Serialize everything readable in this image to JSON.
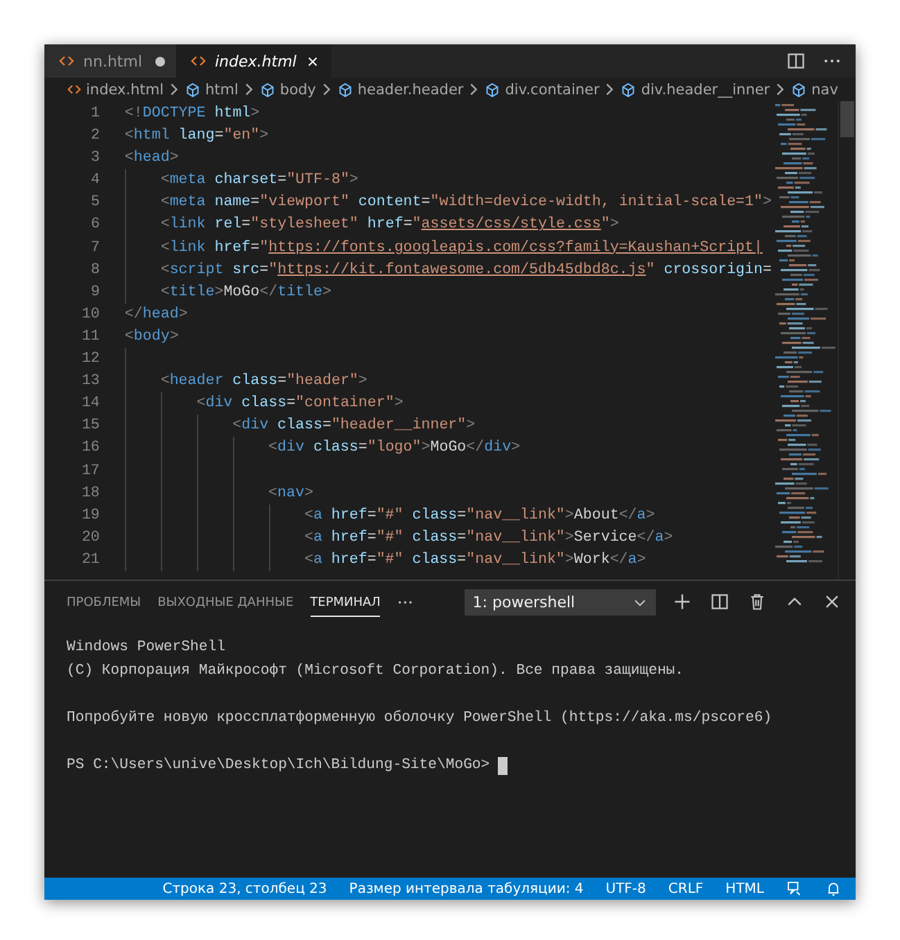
{
  "editor_tabs": [
    {
      "label": "nn.html",
      "selected": false,
      "modified": true,
      "italic": false
    },
    {
      "label": "index.html",
      "selected": true,
      "modified": false,
      "italic": true
    }
  ],
  "breadcrumbs": [
    {
      "kind": "file",
      "label": "index.html"
    },
    {
      "kind": "element",
      "label": "html"
    },
    {
      "kind": "element",
      "label": "body"
    },
    {
      "kind": "element",
      "label": "header.header"
    },
    {
      "kind": "element",
      "label": "div.container"
    },
    {
      "kind": "element",
      "label": "div.header__inner"
    },
    {
      "kind": "element",
      "label": "nav"
    }
  ],
  "code_lines": [
    {
      "number": "1",
      "tokens": [
        {
          "kind": "punct",
          "text": "<!"
        },
        {
          "kind": "tag",
          "text": "DOCTYPE"
        },
        {
          "kind": "attr",
          "text": " html"
        },
        {
          "kind": "punct",
          "text": ">"
        }
      ]
    },
    {
      "number": "2",
      "tokens": [
        {
          "kind": "punct",
          "text": "<"
        },
        {
          "kind": "tag",
          "text": "html"
        },
        {
          "kind": "attr",
          "text": " lang"
        },
        {
          "kind": "text",
          "text": "="
        },
        {
          "kind": "string",
          "text": "\"en\""
        },
        {
          "kind": "punct",
          "text": ">"
        }
      ]
    },
    {
      "number": "3",
      "tokens": [
        {
          "kind": "punct",
          "text": "<"
        },
        {
          "kind": "tag",
          "text": "head"
        },
        {
          "kind": "punct",
          "text": ">"
        }
      ],
      "children": [
        {
          "number": "4",
          "tokens": [
            {
              "kind": "punct",
              "text": "<"
            },
            {
              "kind": "tag",
              "text": "meta"
            },
            {
              "kind": "attr",
              "text": " charset"
            },
            {
              "kind": "text",
              "text": "="
            },
            {
              "kind": "string",
              "text": "\"UTF-8\""
            },
            {
              "kind": "punct",
              "text": ">"
            }
          ]
        },
        {
          "number": "5",
          "tokens": [
            {
              "kind": "punct",
              "text": "<"
            },
            {
              "kind": "tag",
              "text": "meta"
            },
            {
              "kind": "attr",
              "text": " name"
            },
            {
              "kind": "text",
              "text": "="
            },
            {
              "kind": "string",
              "text": "\"viewport\""
            },
            {
              "kind": "attr",
              "text": " content"
            },
            {
              "kind": "text",
              "text": "="
            },
            {
              "kind": "string",
              "text": "\"width=device-width, initial-scale=1\""
            },
            {
              "kind": "punct",
              "text": ">"
            }
          ]
        },
        {
          "number": "6",
          "tokens": [
            {
              "kind": "punct",
              "text": "<"
            },
            {
              "kind": "tag",
              "text": "link"
            },
            {
              "kind": "attr",
              "text": " rel"
            },
            {
              "kind": "text",
              "text": "="
            },
            {
              "kind": "string",
              "text": "\"stylesheet\""
            },
            {
              "kind": "attr",
              "text": " href"
            },
            {
              "kind": "text",
              "text": "="
            },
            {
              "kind": "string",
              "text": "\""
            },
            {
              "kind": "link",
              "text": "assets/css/style.css"
            },
            {
              "kind": "string",
              "text": "\""
            },
            {
              "kind": "punct",
              "text": ">"
            }
          ]
        },
        {
          "number": "7",
          "tokens": [
            {
              "kind": "punct",
              "text": "<"
            },
            {
              "kind": "tag",
              "text": "link"
            },
            {
              "kind": "attr",
              "text": " href"
            },
            {
              "kind": "text",
              "text": "="
            },
            {
              "kind": "string",
              "text": "\""
            },
            {
              "kind": "link",
              "text": "https://fonts.googleapis.com/css?family=Kaushan+Script|"
            }
          ]
        },
        {
          "number": "8",
          "tokens": [
            {
              "kind": "punct",
              "text": "<"
            },
            {
              "kind": "tag",
              "text": "script"
            },
            {
              "kind": "attr",
              "text": " src"
            },
            {
              "kind": "text",
              "text": "="
            },
            {
              "kind": "string",
              "text": "\""
            },
            {
              "kind": "link",
              "text": "https://kit.fontawesome.com/5db45dbd8c.js"
            },
            {
              "kind": "string",
              "text": "\""
            },
            {
              "kind": "attr",
              "text": " crossorigin"
            },
            {
              "kind": "text",
              "text": "="
            }
          ]
        },
        {
          "number": "9",
          "tokens": [
            {
              "kind": "punct",
              "text": "<"
            },
            {
              "kind": "tag",
              "text": "title"
            },
            {
              "kind": "punct",
              "text": ">"
            },
            {
              "kind": "text",
              "text": "MoGo"
            },
            {
              "kind": "punct",
              "text": "</"
            },
            {
              "kind": "tag",
              "text": "title"
            },
            {
              "kind": "punct",
              "text": ">"
            }
          ]
        }
      ]
    },
    {
      "number": "10",
      "tokens": [
        {
          "kind": "punct",
          "text": "</"
        },
        {
          "kind": "tag",
          "text": "head"
        },
        {
          "kind": "punct",
          "text": ">"
        }
      ]
    },
    {
      "number": "11",
      "tokens": [
        {
          "kind": "punct",
          "text": "<"
        },
        {
          "kind": "tag",
          "text": "body"
        },
        {
          "kind": "punct",
          "text": ">"
        }
      ],
      "children": [
        {
          "number": "12"
        },
        {
          "number": "13",
          "tokens": [
            {
              "kind": "punct",
              "text": "<"
            },
            {
              "kind": "tag",
              "text": "header"
            },
            {
              "kind": "attr",
              "text": " class"
            },
            {
              "kind": "text",
              "text": "="
            },
            {
              "kind": "string",
              "text": "\"header\""
            },
            {
              "kind": "punct",
              "text": ">"
            }
          ],
          "children": [
            {
              "number": "14",
              "tokens": [
                {
                  "kind": "punct",
                  "text": "<"
                },
                {
                  "kind": "tag",
                  "text": "div"
                },
                {
                  "kind": "attr",
                  "text": " class"
                },
                {
                  "kind": "text",
                  "text": "="
                },
                {
                  "kind": "string",
                  "text": "\"container\""
                },
                {
                  "kind": "punct",
                  "text": ">"
                }
              ],
              "children": [
                {
                  "number": "15",
                  "tokens": [
                    {
                      "kind": "punct",
                      "text": "<"
                    },
                    {
                      "kind": "tag",
                      "text": "div"
                    },
                    {
                      "kind": "attr",
                      "text": " class"
                    },
                    {
                      "kind": "text",
                      "text": "="
                    },
                    {
                      "kind": "string",
                      "text": "\"header__inner\""
                    },
                    {
                      "kind": "punct",
                      "text": ">"
                    }
                  ],
                  "children": [
                    {
                      "number": "16",
                      "tokens": [
                        {
                          "kind": "punct",
                          "text": "<"
                        },
                        {
                          "kind": "tag",
                          "text": "div"
                        },
                        {
                          "kind": "attr",
                          "text": " class"
                        },
                        {
                          "kind": "text",
                          "text": "="
                        },
                        {
                          "kind": "string",
                          "text": "\"logo\""
                        },
                        {
                          "kind": "punct",
                          "text": ">"
                        },
                        {
                          "kind": "text",
                          "text": "MoGo"
                        },
                        {
                          "kind": "punct",
                          "text": "</"
                        },
                        {
                          "kind": "tag",
                          "text": "div"
                        },
                        {
                          "kind": "punct",
                          "text": ">"
                        }
                      ]
                    },
                    {
                      "number": "17"
                    },
                    {
                      "number": "18",
                      "tokens": [
                        {
                          "kind": "punct",
                          "text": "<"
                        },
                        {
                          "kind": "tag",
                          "text": "nav"
                        },
                        {
                          "kind": "punct",
                          "text": ">"
                        }
                      ],
                      "children": [
                        {
                          "number": "19",
                          "tokens": [
                            {
                              "kind": "punct",
                              "text": "<"
                            },
                            {
                              "kind": "tag",
                              "text": "a"
                            },
                            {
                              "kind": "attr",
                              "text": " href"
                            },
                            {
                              "kind": "text",
                              "text": "="
                            },
                            {
                              "kind": "string",
                              "text": "\"#\""
                            },
                            {
                              "kind": "attr",
                              "text": " class"
                            },
                            {
                              "kind": "text",
                              "text": "="
                            },
                            {
                              "kind": "string",
                              "text": "\"nav__link\""
                            },
                            {
                              "kind": "punct",
                              "text": ">"
                            },
                            {
                              "kind": "text",
                              "text": "About"
                            },
                            {
                              "kind": "punct",
                              "text": "</"
                            },
                            {
                              "kind": "tag",
                              "text": "a"
                            },
                            {
                              "kind": "punct",
                              "text": ">"
                            }
                          ]
                        },
                        {
                          "number": "20",
                          "tokens": [
                            {
                              "kind": "punct",
                              "text": "<"
                            },
                            {
                              "kind": "tag",
                              "text": "a"
                            },
                            {
                              "kind": "attr",
                              "text": " href"
                            },
                            {
                              "kind": "text",
                              "text": "="
                            },
                            {
                              "kind": "string",
                              "text": "\"#\""
                            },
                            {
                              "kind": "attr",
                              "text": " class"
                            },
                            {
                              "kind": "text",
                              "text": "="
                            },
                            {
                              "kind": "string",
                              "text": "\"nav__link\""
                            },
                            {
                              "kind": "punct",
                              "text": ">"
                            },
                            {
                              "kind": "text",
                              "text": "Service"
                            },
                            {
                              "kind": "punct",
                              "text": "</"
                            },
                            {
                              "kind": "tag",
                              "text": "a"
                            },
                            {
                              "kind": "punct",
                              "text": ">"
                            }
                          ]
                        },
                        {
                          "number": "21",
                          "tokens": [
                            {
                              "kind": "punct",
                              "text": "<"
                            },
                            {
                              "kind": "tag",
                              "text": "a"
                            },
                            {
                              "kind": "attr",
                              "text": " href"
                            },
                            {
                              "kind": "text",
                              "text": "="
                            },
                            {
                              "kind": "string",
                              "text": "\"#\""
                            },
                            {
                              "kind": "attr",
                              "text": " class"
                            },
                            {
                              "kind": "text",
                              "text": "="
                            },
                            {
                              "kind": "string",
                              "text": "\"nav__link\""
                            },
                            {
                              "kind": "punct",
                              "text": ">"
                            },
                            {
                              "kind": "text",
                              "text": "Work"
                            },
                            {
                              "kind": "punct",
                              "text": "</"
                            },
                            {
                              "kind": "tag",
                              "text": "a"
                            },
                            {
                              "kind": "punct",
                              "text": ">"
                            }
                          ]
                        }
                      ]
                    }
                  ]
                }
              ]
            }
          ]
        }
      ]
    }
  ],
  "panel_tabs": [
    {
      "label": "ПРОБЛЕМЫ",
      "selected": false
    },
    {
      "label": "ВЫХОДНЫЕ ДАННЫЕ",
      "selected": false
    },
    {
      "label": "ТЕРМИНАЛ",
      "selected": true
    }
  ],
  "terminal_select": {
    "value": "1: powershell"
  },
  "terminal_blocks": [
    [
      "Windows PowerShell",
      "(C) Корпорация Майкрософт (Microsoft Corporation). Все права защищены."
    ],
    [
      "Попробуйте новую кроссплатформенную оболочку PowerShell (https://aka.ms/pscore6)"
    ],
    [
      "PS C:\\Users\\unive\\Desktop\\Ich\\Bildung-Site\\MoGo>"
    ]
  ],
  "status_bar": [
    "Строка 23, столбец 23",
    "Размер интервала табуляции: 4",
    "UTF-8",
    "CRLF",
    "HTML"
  ]
}
